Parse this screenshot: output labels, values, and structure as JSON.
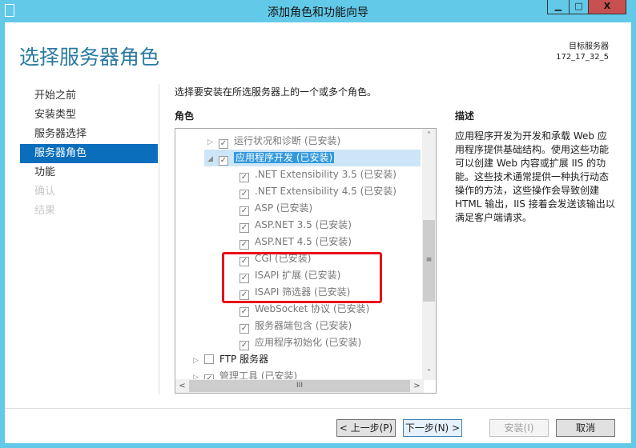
{
  "window": {
    "title": "添加角色和功能向导",
    "minimize": "▁",
    "maximize": "□",
    "close": "X"
  },
  "header": {
    "page_title": "选择服务器角色",
    "target_label": "目标服务器",
    "target_value": "172_17_32_5"
  },
  "nav": {
    "items": [
      {
        "label": "开始之前",
        "state": "normal"
      },
      {
        "label": "安装类型",
        "state": "normal"
      },
      {
        "label": "服务器选择",
        "state": "normal"
      },
      {
        "label": "服务器角色",
        "state": "active"
      },
      {
        "label": "功能",
        "state": "normal"
      },
      {
        "label": "确认",
        "state": "disabled"
      },
      {
        "label": "结果",
        "state": "disabled"
      }
    ]
  },
  "main": {
    "instruction": "选择要安装在所选服务器上的一个或多个角色。",
    "roles_heading": "角色",
    "description_heading": "描述",
    "description": "应用程序开发为开发和承载 Web 应用程序提供基础结构。使用这些功能可以创建 Web 内容或扩展 IIS 的功能。这些技术通常提供一种执行动态操作的方法，这些操作会导致创建 HTML 输出，IIS 接着会发送该输出以满足客户端请求。",
    "roles": [
      {
        "label": "运行状况和诊断 (已安装)",
        "checked": true,
        "level": 1,
        "expander": "▷"
      },
      {
        "label": "应用程序开发 (已安装)",
        "checked": true,
        "level": 1,
        "expander": "◢",
        "selected": true
      },
      {
        "label": ".NET Extensibility 3.5 (已安装)",
        "checked": true,
        "level": 2
      },
      {
        "label": ".NET Extensibility 4.5 (已安装)",
        "checked": true,
        "level": 2
      },
      {
        "label": "ASP (已安装)",
        "checked": true,
        "level": 2
      },
      {
        "label": "ASP.NET 3.5 (已安装)",
        "checked": true,
        "level": 2
      },
      {
        "label": "ASP.NET 4.5 (已安装)",
        "checked": true,
        "level": 2
      },
      {
        "label": "CGI (已安装)",
        "checked": true,
        "level": 2
      },
      {
        "label": "ISAPI 扩展 (已安装)",
        "checked": true,
        "level": 2
      },
      {
        "label": "ISAPI 筛选器 (已安装)",
        "checked": true,
        "level": 2
      },
      {
        "label": "WebSocket 协议 (已安装)",
        "checked": true,
        "level": 2
      },
      {
        "label": "服务器端包含 (已安装)",
        "checked": true,
        "level": 2
      },
      {
        "label": "应用程序初始化 (已安装)",
        "checked": true,
        "level": 2
      },
      {
        "label": "FTP 服务器",
        "checked": false,
        "level": 0,
        "expander": "▷",
        "dark": true
      },
      {
        "label": "管理工具 (已安装)",
        "checked": true,
        "level": 0,
        "expander": "▷"
      }
    ]
  },
  "buttons": {
    "prev": "< 上一步(P)",
    "next": "下一步(N) >",
    "install": "安装(I)",
    "cancel": "取消"
  },
  "colors": {
    "accent": "#0a6ebd",
    "frame": "#62c9e8",
    "highlight_box": "#e8101a"
  }
}
